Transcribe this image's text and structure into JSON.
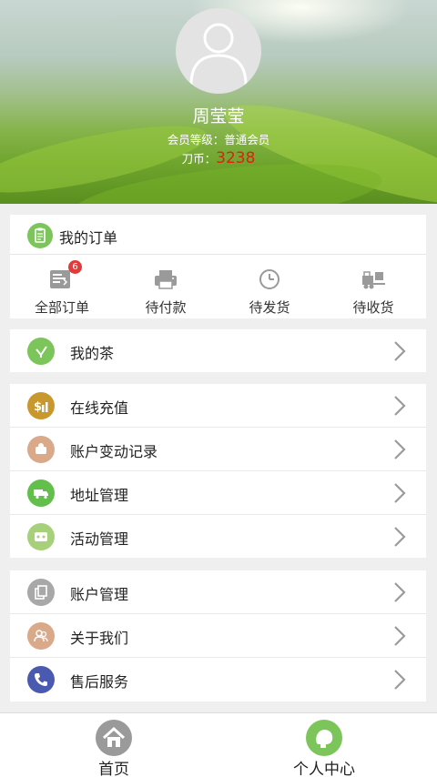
{
  "profile": {
    "name": "周莹莹",
    "member_level": "会员等级：普通会员",
    "coins_label": "刀币：",
    "coins_value": "3238"
  },
  "orders": {
    "title": "我的订单",
    "items": [
      {
        "label": "全部订单",
        "icon": "order-list-icon",
        "badge": "6"
      },
      {
        "label": "待付款",
        "icon": "printer-icon"
      },
      {
        "label": "待发货",
        "icon": "clock-icon"
      },
      {
        "label": "待收货",
        "icon": "forklift-icon"
      }
    ]
  },
  "tea": {
    "label": "我的茶",
    "icon": "tea-sprout-icon",
    "color": "#7cc55a"
  },
  "finance": [
    {
      "label": "在线充值",
      "icon": "recharge-icon",
      "color": "#c8982e"
    },
    {
      "label": "账户变动记录",
      "icon": "record-icon",
      "color": "#d9a98a"
    },
    {
      "label": "地址管理",
      "icon": "truck-icon",
      "color": "#63bf4c"
    },
    {
      "label": "活动管理",
      "icon": "activity-icon",
      "color": "#a7d07a"
    }
  ],
  "account": [
    {
      "label": "账户管理",
      "icon": "account-icon",
      "color": "#a8a8a8"
    },
    {
      "label": "关于我们",
      "icon": "about-users-icon",
      "color": "#d9a98a"
    },
    {
      "label": "售后服务",
      "icon": "phone-icon",
      "color": "#4a5ab0"
    }
  ],
  "tabbar": [
    {
      "label": "首页",
      "icon": "home-icon",
      "active": false
    },
    {
      "label": "个人中心",
      "icon": "personal-center-icon",
      "active": true
    }
  ]
}
